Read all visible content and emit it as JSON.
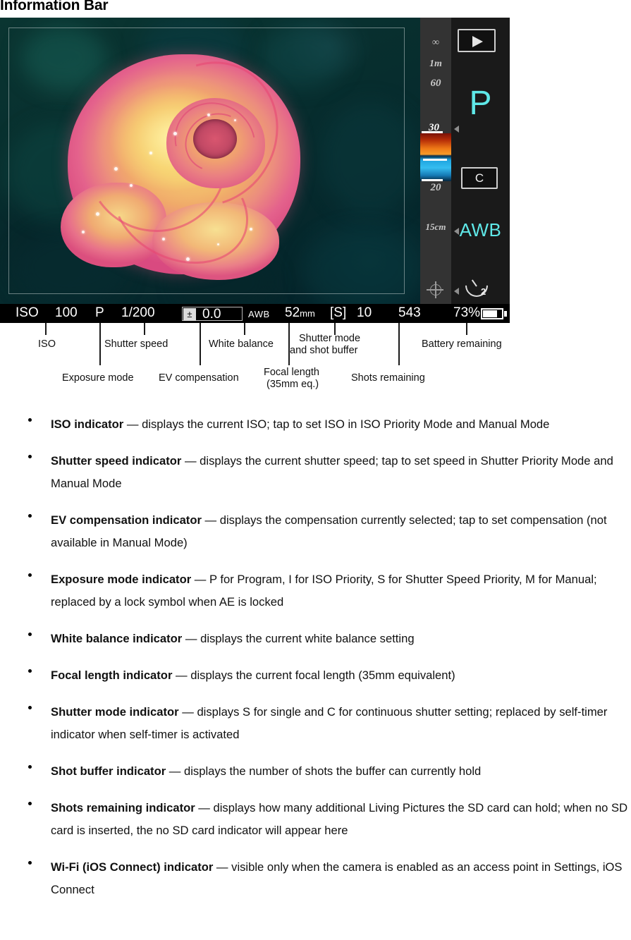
{
  "heading": "Information Bar",
  "camera": {
    "focus_scale": {
      "infinity": "∞",
      "one_meter": "1m",
      "sixty": "60",
      "thirty": "30",
      "twenty": "20",
      "fifteen_cm": "15cm"
    },
    "controls": {
      "play_icon": "play-icon",
      "exposure_mode": "P",
      "shutter_mode_icon_label": "C",
      "white_balance": "AWB",
      "self_timer_seconds": "2"
    },
    "info_bar": {
      "iso_label": "ISO",
      "iso_value": "100",
      "exposure_mode": "P",
      "shutter_speed": "1/200",
      "ev_icon": "±",
      "ev_value": "0.0",
      "white_balance": "AWB",
      "focal_length": "52",
      "focal_unit": "mm",
      "shutter_mode": "[S]",
      "shot_buffer": "10",
      "shots_remaining": "543",
      "battery_percent": "73%"
    }
  },
  "callouts": {
    "iso": "ISO",
    "shutter_speed": "Shutter speed",
    "white_balance": "White balance",
    "shutter_mode_buffer_line1": "Shutter mode",
    "shutter_mode_buffer_line2": "and shot buffer",
    "battery_remaining": "Battery remaining",
    "exposure_mode": "Exposure mode",
    "ev_compensation": "EV compensation",
    "focal_length_line1": "Focal length",
    "focal_length_line2": "(35mm eq.)",
    "shots_remaining": "Shots remaining"
  },
  "bullets": [
    {
      "term": "ISO indicator",
      "dash": " — ",
      "text": "displays the current ISO; tap to set ISO in ISO Priority Mode and Manual Mode"
    },
    {
      "term": "Shutter speed indicator",
      "dash": " — ",
      "text": "displays the current shutter speed; tap to set speed in Shutter Priority Mode and Manual Mode"
    },
    {
      "term": "EV compensation indicator",
      "dash": " — ",
      "text": "displays the compensation currently selected; tap to set compensation (not available in Manual Mode)"
    },
    {
      "term": "Exposure mode indicator",
      "dash": " — ",
      "text": "P for Program, I for ISO Priority, S for Shutter Speed Priority, M for Manual; replaced by a lock symbol when AE is locked"
    },
    {
      "term": "White balance indicator",
      "dash": " — ",
      "text": "displays the current white balance setting"
    },
    {
      "term": "Focal length indicator",
      "dash": " — ",
      "text": "displays the current focal length (35mm equivalent)"
    },
    {
      "term": "Shutter mode indicator",
      "dash": " — ",
      "text": "displays S for single and C for continuous shutter setting; replaced by self-timer indicator when self-timer is activated"
    },
    {
      "term": "Shot buffer indicator",
      "dash": " — ",
      "text": "displays the number of shots the buffer can currently hold"
    },
    {
      "term": "Shots remaining indicator",
      "dash": " — ",
      "text": "displays how many additional Living Pictures the SD card can hold; when no SD card is inserted, the no SD card indicator will appear here"
    },
    {
      "term": "Wi-Fi (iOS Connect) indicator",
      "dash": " — ",
      "text": "visible only when the camera is enabled as an access point in Settings, iOS Connect"
    }
  ],
  "colors": {
    "accent_cyan": "#5fe8e8",
    "info_bar_bg": "#000000",
    "focus_bar_bg": "#333333",
    "panel_bg": "#1a1a1a"
  }
}
